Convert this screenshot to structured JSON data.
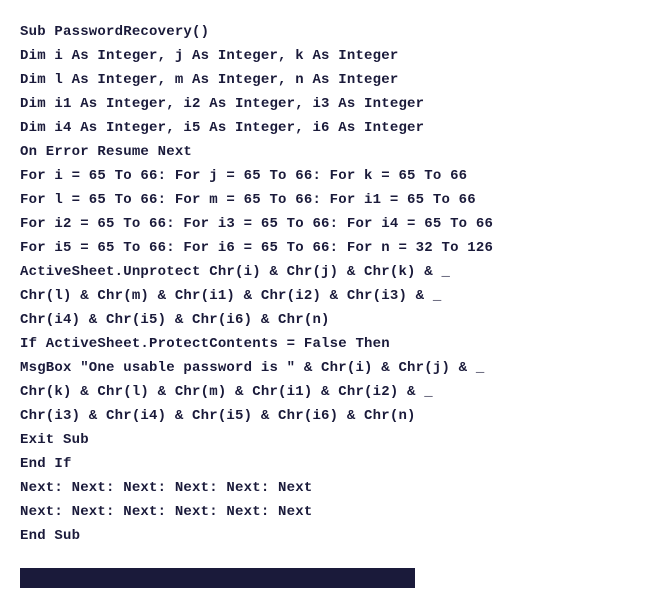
{
  "code": {
    "lines": [
      "Sub PasswordRecovery()",
      "Dim i As Integer, j As Integer, k As Integer",
      "Dim l As Integer, m As Integer, n As Integer",
      "Dim i1 As Integer, i2 As Integer, i3 As Integer",
      "Dim i4 As Integer, i5 As Integer, i6 As Integer",
      "On Error Resume Next",
      "For i = 65 To 66: For j = 65 To 66: For k = 65 To 66",
      "For l = 65 To 66: For m = 65 To 66: For i1 = 65 To 66",
      "For i2 = 65 To 66: For i3 = 65 To 66: For i4 = 65 To 66",
      "For i5 = 65 To 66: For i6 = 65 To 66: For n = 32 To 126",
      "ActiveSheet.Unprotect Chr(i) & Chr(j) & Chr(k) & _",
      "Chr(l) & Chr(m) & Chr(i1) & Chr(i2) & Chr(i3) & _",
      "Chr(i4) & Chr(i5) & Chr(i6) & Chr(n)",
      "If ActiveSheet.ProtectContents = False Then",
      "MsgBox \"One usable password is \" & Chr(i) & Chr(j) & _",
      "Chr(k) & Chr(l) & Chr(m) & Chr(i1) & Chr(i2) & _",
      "Chr(i3) & Chr(i4) & Chr(i5) & Chr(i6) & Chr(n)",
      "Exit Sub",
      "End If",
      "Next: Next: Next: Next: Next: Next",
      "Next: Next: Next: Next: Next: Next",
      "End Sub"
    ]
  }
}
